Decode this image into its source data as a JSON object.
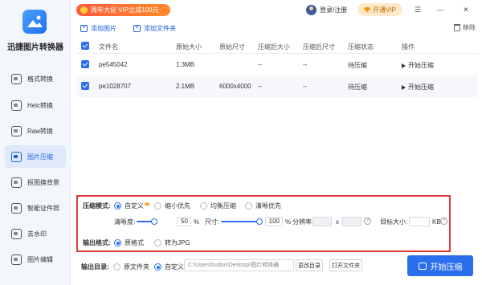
{
  "app": {
    "title": "迅捷图片转换器"
  },
  "sidebar": {
    "items": [
      {
        "label": "格式转换",
        "icon": "format-convert-icon"
      },
      {
        "label": "Heic转换",
        "icon": "heic-icon"
      },
      {
        "label": "Raw转换",
        "icon": "raw-icon"
      },
      {
        "label": "图片压缩",
        "icon": "compress-icon",
        "active": true
      },
      {
        "label": "抠图换背景",
        "icon": "cutout-icon"
      },
      {
        "label": "智能证件照",
        "icon": "id-photo-icon"
      },
      {
        "label": "去水印",
        "icon": "watermark-icon"
      },
      {
        "label": "图片编辑",
        "icon": "edit-icon"
      }
    ]
  },
  "topbar": {
    "promo": "周年大促 VIP立减100元",
    "login": "登录/注册",
    "vip": "开通VIP",
    "window_controls": [
      "☰",
      "—",
      "✕"
    ]
  },
  "toolbar": {
    "add_image": "添加图片",
    "add_folder": "添加文件夹",
    "remove": "移除"
  },
  "table": {
    "columns": [
      "文件名",
      "原始大小",
      "原始尺寸",
      "压缩后大小",
      "压缩后尺寸",
      "压缩状态",
      "操作"
    ],
    "rows": [
      {
        "name": "pe545042",
        "size": "1.3MB",
        "dims": "",
        "out_size": "--",
        "out_dims": "--",
        "status": "待压缩",
        "action": "开始压缩"
      },
      {
        "name": "pe1028707",
        "size": "2.1MB",
        "dims": "6000x4000",
        "out_size": "--",
        "out_dims": "--",
        "status": "待压缩",
        "action": "开始压缩"
      }
    ]
  },
  "settings": {
    "mode_label": "压缩模式:",
    "modes": [
      "自定义",
      "缩小优先",
      "均衡压缩",
      "清晰优先"
    ],
    "clarity_label": "清晰度:",
    "clarity_value": "50",
    "clarity_unit": "%",
    "clarity_fraction": 0.5,
    "size_label": "尺寸:",
    "size_value": "100",
    "size_unit": "%",
    "size_fraction": 1.0,
    "resolution_label": "分辨率:",
    "resolution_x": "x",
    "target_label": "目标大小:",
    "target_unit": "KB",
    "output_format_label": "输出格式:",
    "formats": [
      "原格式",
      "转为JPG"
    ]
  },
  "footer": {
    "output_dir_label": "输出目录:",
    "dir_options": [
      "原文件夹",
      "自定义"
    ],
    "path": "C:\\Users\\hudun\\Desktop\\图片转换器",
    "change_dir": "更改目录",
    "open_folder": "打开文件夹",
    "start_all": "开始压缩"
  },
  "colors": {
    "accent": "#2b6fee",
    "highlight_border": "#e03a3a",
    "promo": "#ff5a3c"
  }
}
